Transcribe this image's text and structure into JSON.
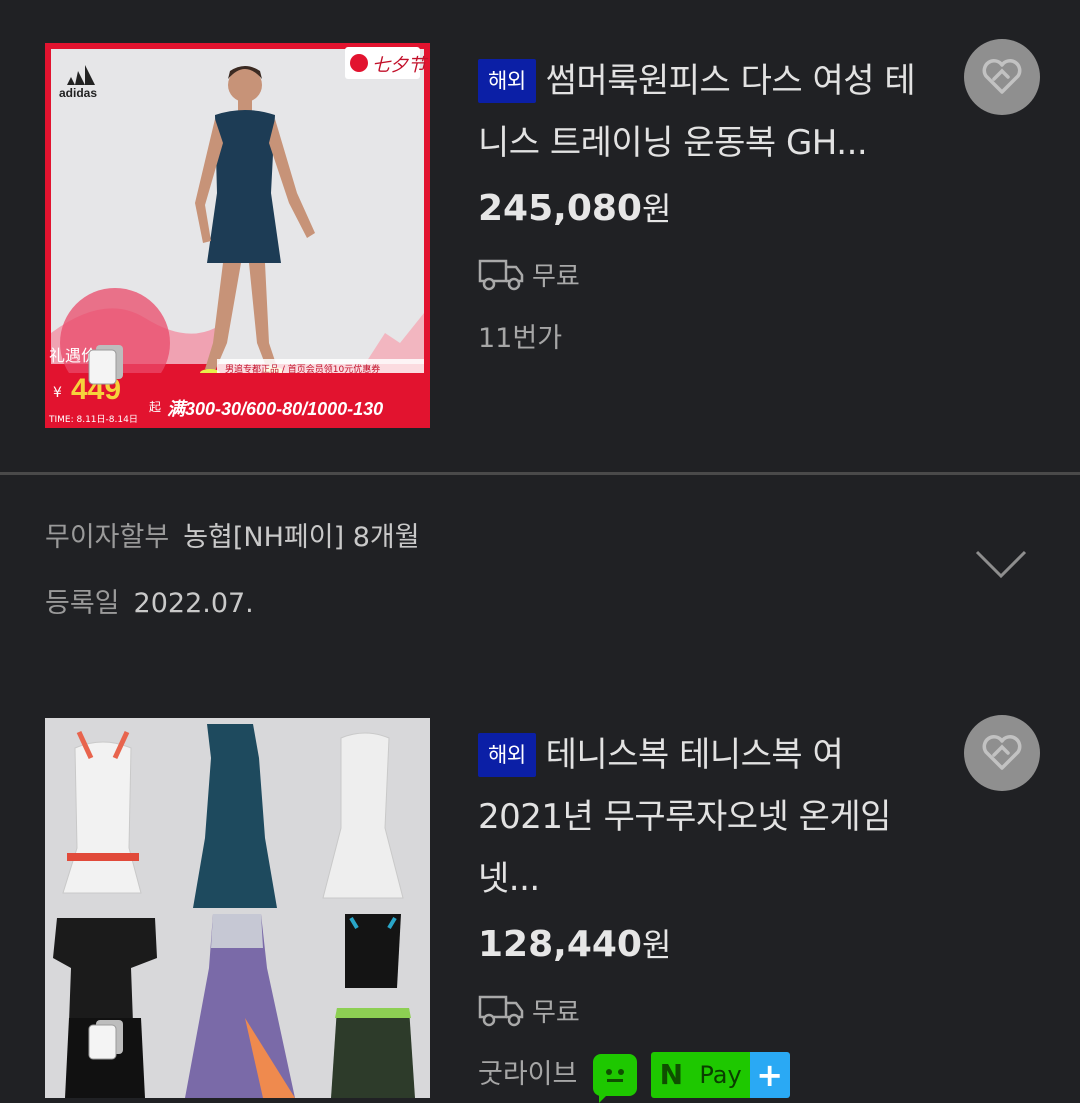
{
  "products": [
    {
      "badge": "해외",
      "title": "썸머룩원피스 다스 여성 테니스 트레이닝 운동복 GH...",
      "price": "245,080",
      "unit": "원",
      "shipping": "무료",
      "seller": "11번가",
      "image": {
        "brand": "adidas",
        "stamp": "七夕节",
        "side_label": "礼遇价",
        "currency": "¥",
        "sale_price": "449",
        "sale_suffix": "起",
        "dates": "TIME: 8.11日-8.14日",
        "banner_text": "男追专都正品 / 首页会员领10元优惠券",
        "promo": "满300-30/600-80/1000-130"
      }
    },
    {
      "badge": "해외",
      "title": "테니스복 테니스복 여 2021년 무구루자오넷 온게임넷...",
      "price": "128,440",
      "unit": "원",
      "shipping": "무료",
      "seller": "굿라이브",
      "npay_pay": "Pay",
      "npay_n": "N",
      "npay_plus": "+"
    }
  ],
  "detail": {
    "installment_label": "무이자할부",
    "installment_value": "농협[NH페이] 8개월",
    "registered_label": "등록일",
    "registered_value": "2022.07."
  },
  "colors": {
    "background": "#202124",
    "badge": "#0b1fa6",
    "naver_green": "#1ec800",
    "npay_plus": "#2aa9f4"
  },
  "icons": [
    "truck-icon",
    "heart-icon",
    "chevron-down-icon",
    "gallery-icon",
    "naver-talk-icon",
    "npay-logo"
  ]
}
